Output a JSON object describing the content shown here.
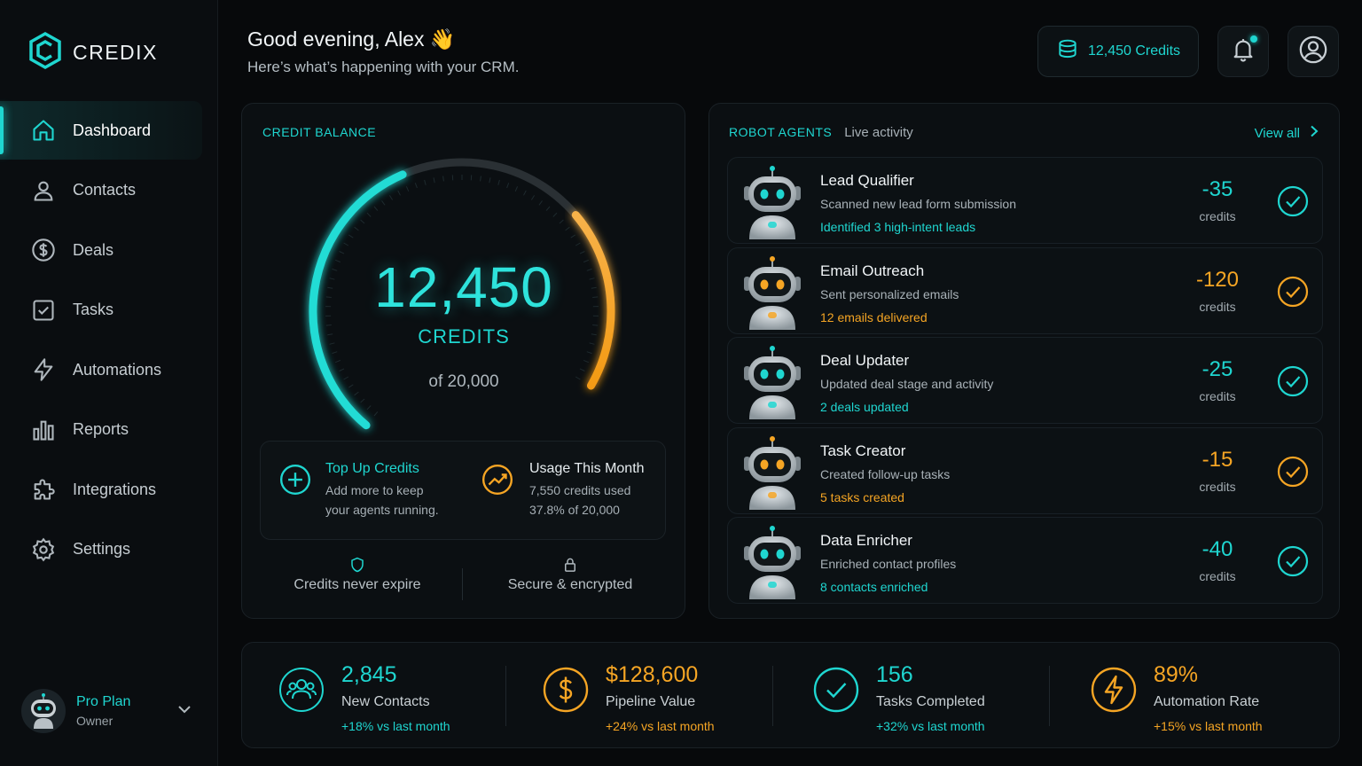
{
  "colors": {
    "accent": "#1fd6d0",
    "warning": "#f5a524",
    "background": "#07090b"
  },
  "brand": {
    "name": "CREDIX"
  },
  "sidebar": {
    "items": [
      {
        "label": "Dashboard",
        "icon": "home-icon",
        "active": true
      },
      {
        "label": "Contacts",
        "icon": "user-icon"
      },
      {
        "label": "Deals",
        "icon": "dollar-icon"
      },
      {
        "label": "Tasks",
        "icon": "checkbox-icon"
      },
      {
        "label": "Automations",
        "icon": "lightning-icon"
      },
      {
        "label": "Reports",
        "icon": "bar-chart-icon"
      },
      {
        "label": "Integrations",
        "icon": "puzzle-icon"
      },
      {
        "label": "Settings",
        "icon": "gear-icon"
      }
    ],
    "plan": {
      "name": "Pro Plan",
      "role": "Owner"
    }
  },
  "header": {
    "greeting": "Good evening, Alex 👋",
    "subtitle": "Here’s what’s happening with your CRM.",
    "credits_pill": "12,450 Credits"
  },
  "credit_balance": {
    "label": "CREDIT BALANCE",
    "value": "12,450",
    "unit": "CREDITS",
    "of": "of 20,000",
    "fraction_remaining": 0.6225,
    "top_up": {
      "title": "Top Up Credits",
      "line1": "Add more to keep",
      "line2": "your agents running."
    },
    "usage": {
      "title": "Usage This Month",
      "line1": "7,550 credits used",
      "line2": "37.8% of 20,000"
    },
    "footer": {
      "expire": "Credits never expire",
      "secure": "Secure & encrypted"
    }
  },
  "agents": {
    "label": "ROBOT AGENTS",
    "sublabel": "Live activity",
    "view_all": "View all",
    "unit": "credits",
    "rows": [
      {
        "name": "Lead Qualifier",
        "desc": "Scanned new lead form submission",
        "result": "Identified 3 high-intent leads",
        "cost": "-35",
        "tone": "teal"
      },
      {
        "name": "Email Outreach",
        "desc": "Sent personalized emails",
        "result": "12 emails delivered",
        "cost": "-120",
        "tone": "amber"
      },
      {
        "name": "Deal Updater",
        "desc": "Updated deal stage and activity",
        "result": "2 deals updated",
        "cost": "-25",
        "tone": "teal"
      },
      {
        "name": "Task Creator",
        "desc": "Created follow-up tasks",
        "result": "5 tasks created",
        "cost": "-15",
        "tone": "amber"
      },
      {
        "name": "Data Enricher",
        "desc": "Enriched contact profiles",
        "result": "8 contacts enriched",
        "cost": "-40",
        "tone": "teal"
      }
    ]
  },
  "stats": [
    {
      "value": "2,845",
      "label": "New Contacts",
      "delta": "+18% vs last month",
      "tone": "teal",
      "icon": "users-icon"
    },
    {
      "value": "$128,600",
      "label": "Pipeline Value",
      "delta": "+24% vs last month",
      "tone": "amber",
      "icon": "dollar-icon"
    },
    {
      "value": "156",
      "label": "Tasks Completed",
      "delta": "+32% vs last month",
      "tone": "teal",
      "icon": "check-circle-icon"
    },
    {
      "value": "89%",
      "label": "Automation Rate",
      "delta": "+15% vs last month",
      "tone": "amber",
      "icon": "lightning-icon"
    }
  ]
}
